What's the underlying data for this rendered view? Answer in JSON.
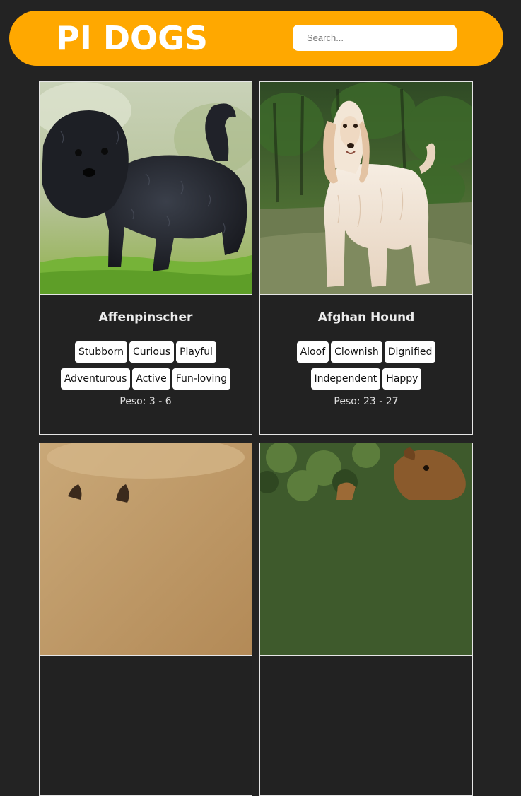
{
  "header": {
    "title": "PI DOGS",
    "search_placeholder": "Search..."
  },
  "colors": {
    "accent": "#ffa800",
    "background": "#232323",
    "card_border": "#e6e6e6"
  },
  "dogs": [
    {
      "name": "Affenpinscher",
      "temperaments": [
        "Stubborn",
        "Curious",
        "Playful",
        "Adventurous",
        "Active",
        "Fun-loving"
      ],
      "weight": "Peso: 3 - 6",
      "image": "black-shaggy-dog"
    },
    {
      "name": "Afghan Hound",
      "temperaments": [
        "Aloof",
        "Clownish",
        "Dignified",
        "Independent",
        "Happy"
      ],
      "weight": "Peso: 23 - 27",
      "image": "cream-longhair-dog"
    },
    {
      "image": "sandy-field-dog"
    },
    {
      "image": "brown-terrier-dog"
    }
  ]
}
